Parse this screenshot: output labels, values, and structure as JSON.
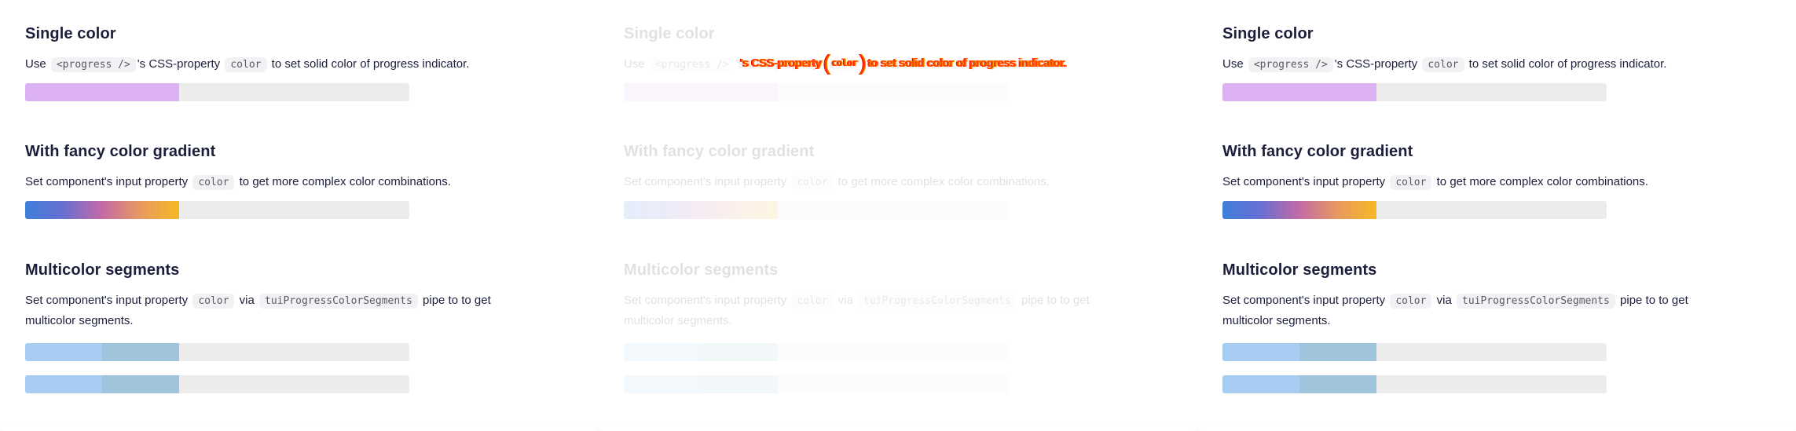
{
  "sections": {
    "single": {
      "title": "Single color",
      "desc_prefix": "Use",
      "code1": "<progress />",
      "desc_mid": "'s CSS-property",
      "code2": "color",
      "desc_suffix": "to set solid color of progress indicator.",
      "progress": 0.4,
      "color": "#dcb2f3"
    },
    "gradient": {
      "title": "With fancy color gradient",
      "desc_prefix": "Set component's input property",
      "code1": "color",
      "desc_suffix": "to get more complex color combinations.",
      "progress": 0.4,
      "colors": [
        "#3f7fdc",
        "#6a6fd2",
        "#c36aa6",
        "#e89a5e",
        "#f6b824"
      ]
    },
    "multicolor": {
      "title": "Multicolor segments",
      "desc_prefix": "Set component's input property",
      "code1": "color",
      "desc_mid": "via",
      "code2": "tuiProgressColorSegments",
      "desc_suffix": "pipe to to get multicolor segments.",
      "progress": 0.4,
      "segment_colors": [
        "#a8cdf2",
        "#a0c4dc"
      ]
    }
  },
  "glitch": {
    "before": "'s CSS-property",
    "code": "color",
    "after": "to set solid color of progress indicator."
  }
}
